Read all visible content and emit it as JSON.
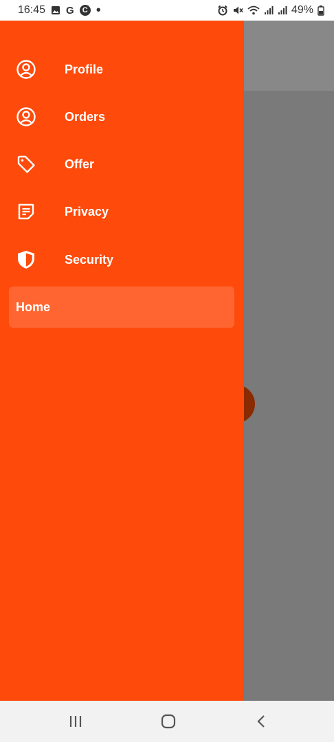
{
  "status_bar": {
    "time": "16:45",
    "g_label": "G",
    "c_label": "C",
    "dot": "•",
    "battery": "49%",
    "icons": [
      "image-icon",
      "google-icon",
      "c-app-icon",
      "alarm-icon",
      "mute-icon",
      "wifi-icon",
      "signal-icon",
      "signal-icon",
      "battery-icon"
    ]
  },
  "drawer": {
    "background": "#fe4a0a",
    "items": [
      {
        "label": "Profile",
        "icon": "user-circle-icon"
      },
      {
        "label": "Orders",
        "icon": "user-circle-icon"
      },
      {
        "label": "Offer",
        "icon": "tag-icon"
      },
      {
        "label": "Privacy",
        "icon": "note-icon"
      },
      {
        "label": "Security",
        "icon": "shield-icon"
      }
    ],
    "selected": {
      "label": "Home",
      "highlight": "#ff6530"
    }
  },
  "nav_bar": {
    "buttons": [
      "recent-apps-icon",
      "home-icon",
      "back-icon"
    ]
  }
}
